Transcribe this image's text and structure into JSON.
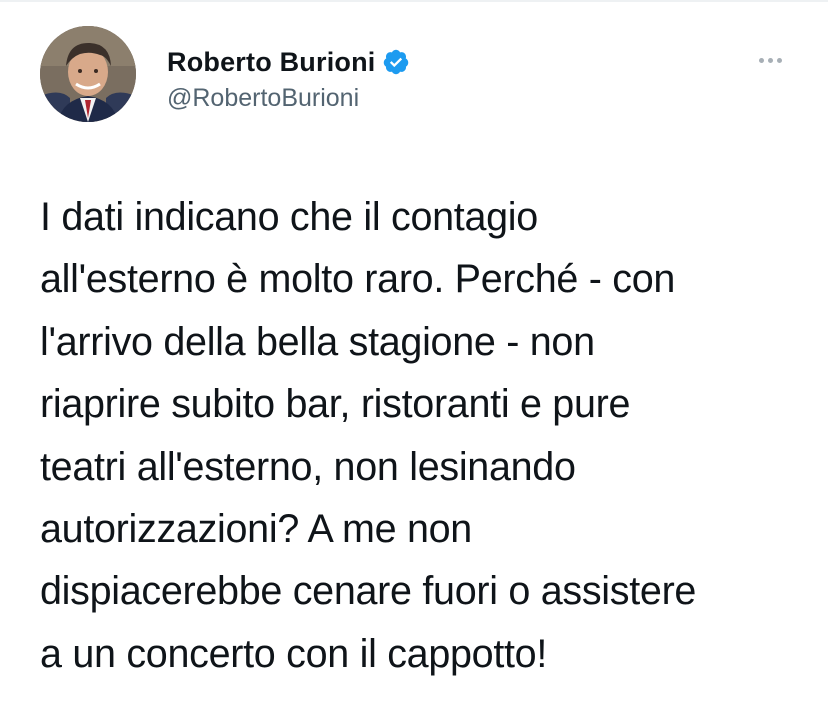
{
  "author": {
    "name": "Roberto Burioni",
    "handle": "@RobertoBurioni",
    "verified": true,
    "avatar_icon": "profile-photo"
  },
  "actions": {
    "more_icon": "more-horizontal-icon"
  },
  "tweet": {
    "text": "I dati indicano che il contagio\nall'esterno è molto raro. Perché - con\nl'arrivo della bella stagione - non\nriaprire subito bar, ristoranti e pure\nteatri all'esterno, non lesinando\nautorizzazioni? A me non\ndispiacerebbe cenare fuori o assistere\na un concerto con il cappotto!"
  },
  "colors": {
    "text": "#0f1419",
    "handle": "#536471",
    "verified": "#1d9bf0",
    "more_dots": "#a7afb6"
  }
}
